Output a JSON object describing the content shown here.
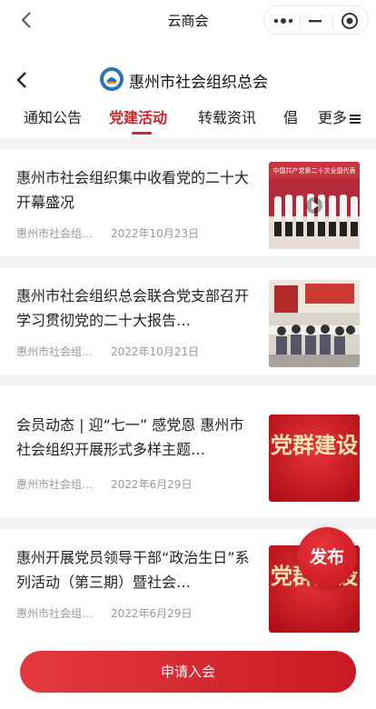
{
  "navbar": {
    "title": "云商会"
  },
  "header": {
    "org_name": "惠州市社会组织总会"
  },
  "tabs": [
    {
      "label": "通知公告"
    },
    {
      "label": "党建活动"
    },
    {
      "label": "转载资讯"
    },
    {
      "label": "倡"
    }
  ],
  "more_tab": {
    "label": "更多"
  },
  "articles": [
    {
      "title": "惠州市社会组织集中收看党的二十大开幕盛况",
      "source": "惠州市社会组织总会",
      "date": "2022年10月23日",
      "thumb_caption": "中国共产党第二十次全国代表"
    },
    {
      "title": "惠州市社会组织总会联合党支部召开学习贯彻党的二十大报告…",
      "source": "惠州市社会组织总会",
      "date": "2022年10月21日"
    },
    {
      "title": "会员动态 | 迎“七一” 感党恩 惠州市社会组织开展形式多样主题…",
      "source": "惠州市社会组织总会",
      "date": "2022年6月29日",
      "thumb_text": "党群建设"
    },
    {
      "title": "惠州开展党员领导干部“政治生日”系列活动（第三期）暨社会…",
      "source": "惠州市社会组织总会",
      "date": "2022年6月29日",
      "thumb_text": "党群建设"
    }
  ],
  "publish_button": {
    "label": "发布"
  },
  "join_button": {
    "label": "申请入会"
  },
  "colors": {
    "accent": "#d4222a",
    "gap": "#f2f2f2"
  }
}
